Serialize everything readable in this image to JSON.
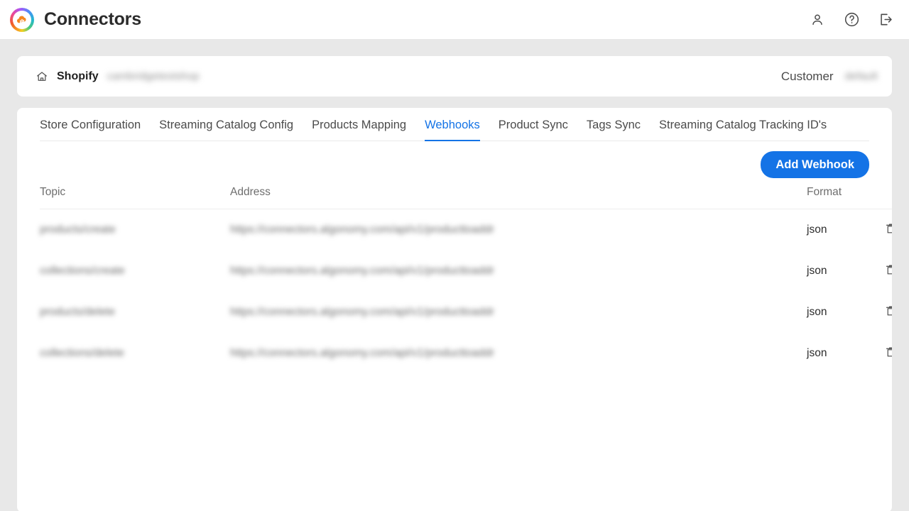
{
  "app": {
    "title": "Connectors",
    "logo_icon": "connectors-cloud-chart-logo",
    "actions": [
      {
        "name": "account-icon",
        "label": "Account"
      },
      {
        "name": "help-icon",
        "label": "Help"
      },
      {
        "name": "logout-icon",
        "label": "Log out"
      }
    ]
  },
  "breadcrumb": {
    "home_icon": "home-icon",
    "connector_name": "Shopify",
    "store_name": "cambridgetestshop",
    "customer_label": "Customer",
    "customer_value": "default"
  },
  "tabs": [
    {
      "label": "Store Configuration",
      "active": false
    },
    {
      "label": "Streaming Catalog Config",
      "active": false
    },
    {
      "label": "Products Mapping",
      "active": false
    },
    {
      "label": "Webhooks",
      "active": true
    },
    {
      "label": "Product Sync",
      "active": false
    },
    {
      "label": "Tags Sync",
      "active": false
    },
    {
      "label": "Streaming Catalog Tracking ID's",
      "active": false
    }
  ],
  "toolbar": {
    "add_webhook_label": "Add Webhook"
  },
  "table": {
    "columns": [
      "Topic",
      "Address",
      "Format"
    ],
    "delete_icon": "trash-icon",
    "rows": [
      {
        "topic": "products/create",
        "address": "https://connectors.algonomy.com/api/v1/producttoaddr",
        "format": "json"
      },
      {
        "topic": "collections/create",
        "address": "https://connectors.algonomy.com/api/v1/producttoaddr",
        "format": "json"
      },
      {
        "topic": "products/delete",
        "address": "https://connectors.algonomy.com/api/v1/producttoaddr",
        "format": "json"
      },
      {
        "topic": "collections/delete",
        "address": "https://connectors.algonomy.com/api/v1/producttoaddr",
        "format": "json"
      }
    ]
  },
  "colors": {
    "accent": "#1473E6",
    "page_background": "#E8E8E8",
    "card_background": "#FFFFFF",
    "text_primary": "#2C2C2C",
    "text_muted": "#6E6E6E"
  }
}
